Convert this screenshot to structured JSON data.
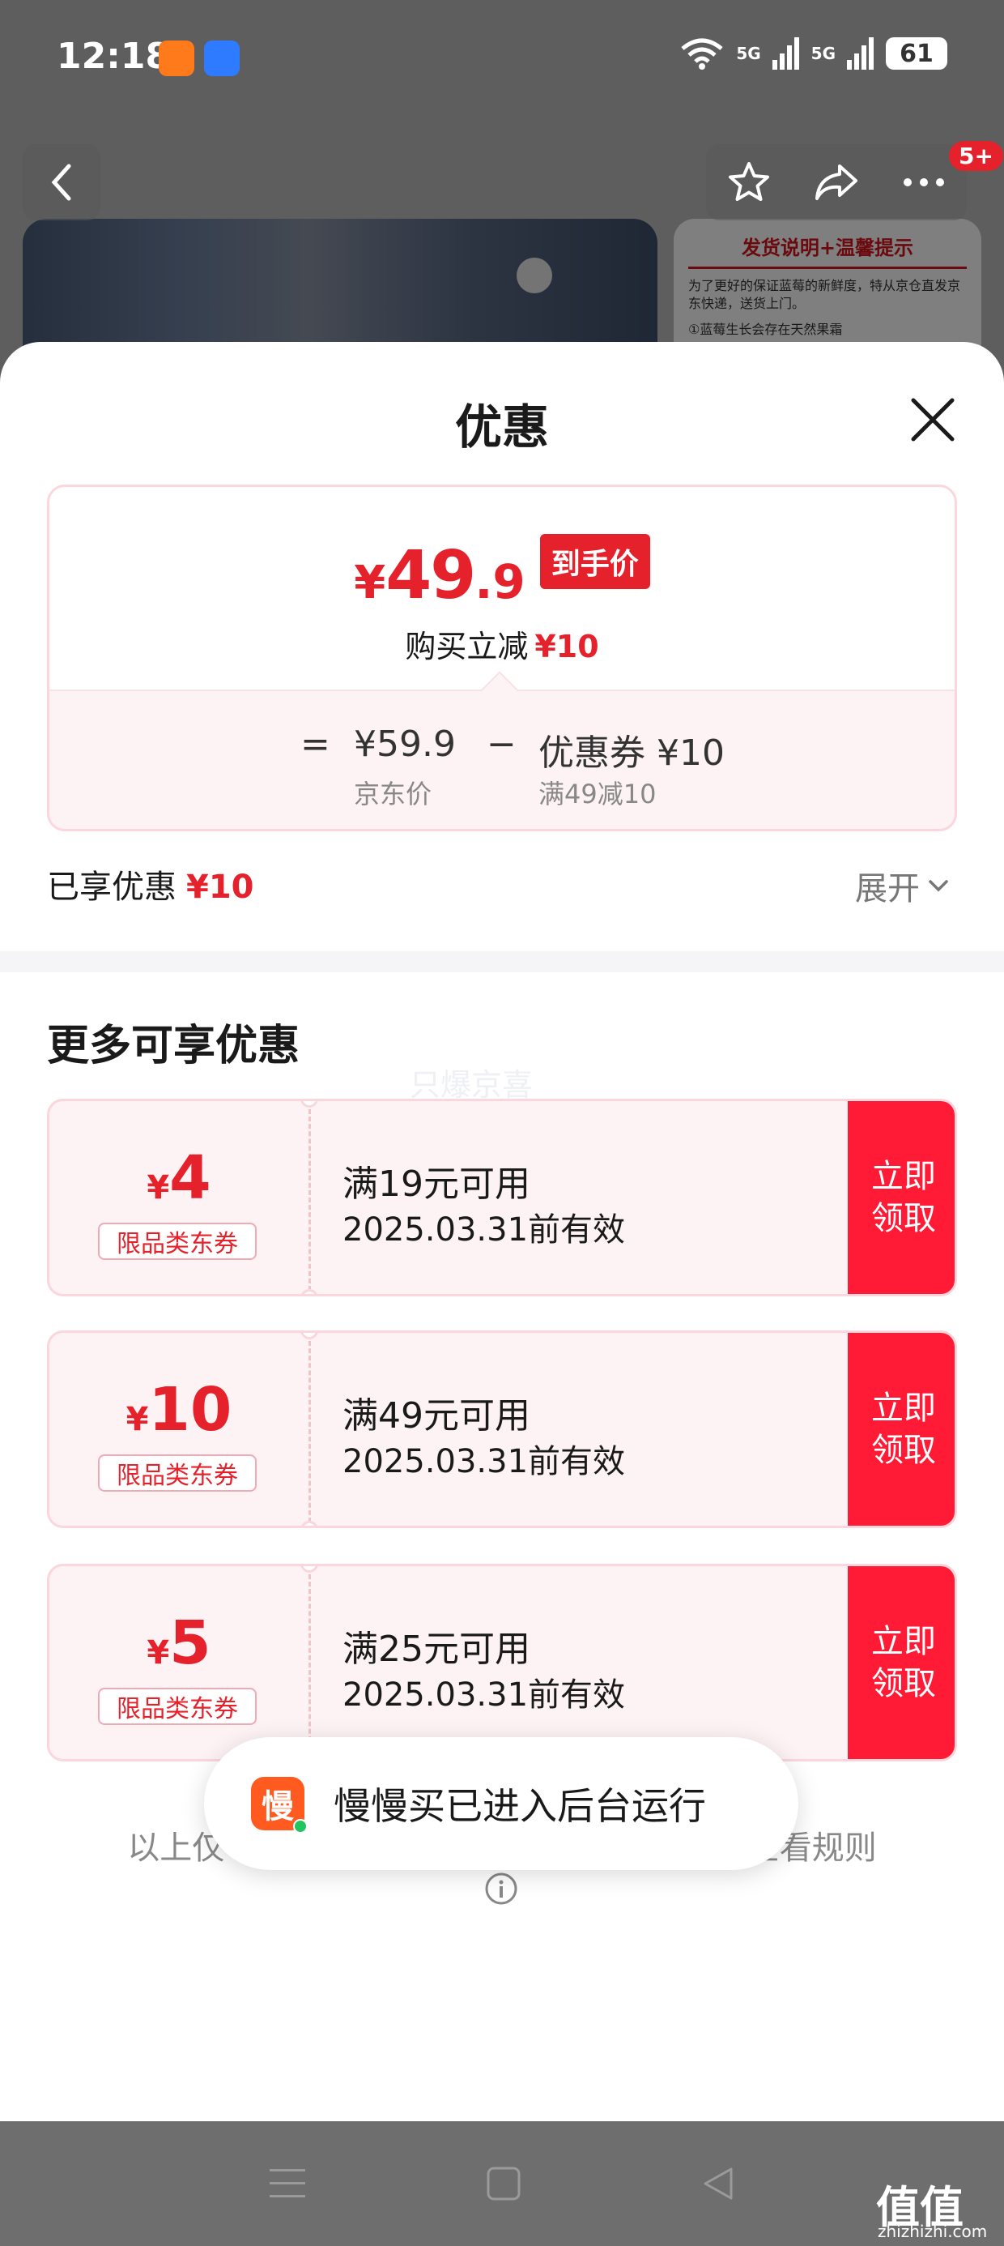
{
  "status_bar": {
    "time": "12:18",
    "signal1": "5G",
    "signal2": "5G",
    "battery": "61"
  },
  "header": {
    "badge": "5+",
    "bg_notice_title": "发货说明+温馨提示",
    "bg_notice_line1": "为了更好的保证蓝莓的新鲜度，特从京仓直发京东快递，送货上门。",
    "bg_notice_line2": "①蓝莓生长会存在天然果霜"
  },
  "sheet": {
    "title": "优惠"
  },
  "price_card": {
    "currency": "¥",
    "price_int": "49",
    "price_dec": ".9",
    "price_tag": "到手价",
    "save_text": "购买立减",
    "save_amount": "¥10",
    "eq": "=",
    "jd_price": "¥59.9",
    "jd_price_label": "京东价",
    "minus": "−",
    "coupon_text": "优惠券 ¥10",
    "coupon_cond": "满49减10"
  },
  "enjoyed": {
    "label": "已享优惠",
    "amount": "¥10",
    "expand": "展开"
  },
  "more": {
    "title": "更多可享优惠",
    "watermark": "只爆京喜"
  },
  "coupons": [
    {
      "currency": "¥",
      "value": "4",
      "kind": "限品类东券",
      "cond": "满19元可用",
      "valid": "2025.03.31前有效",
      "btn1": "立即",
      "btn2": "领取"
    },
    {
      "currency": "¥",
      "value": "10",
      "kind": "限品类东券",
      "cond": "满49元可用",
      "valid": "2025.03.31前有效",
      "btn1": "立即",
      "btn2": "领取"
    },
    {
      "currency": "¥",
      "value": "5",
      "kind": "限品类东券",
      "cond": "满25元可用",
      "valid": "2025.03.31前有效",
      "btn1": "立即",
      "btn2": "领取"
    }
  ],
  "notice": {
    "left": "以上仅",
    "right": "查看规则"
  },
  "toast": {
    "icon_char": "慢",
    "text": "慢慢买已进入后台运行"
  },
  "watermark": {
    "logo": "值值值",
    "url": "zhizhizhi.com"
  },
  "colors": {
    "accent_red": "#e5222b",
    "button_red": "#ff1a35",
    "card_pink": "#fdf3f4"
  }
}
